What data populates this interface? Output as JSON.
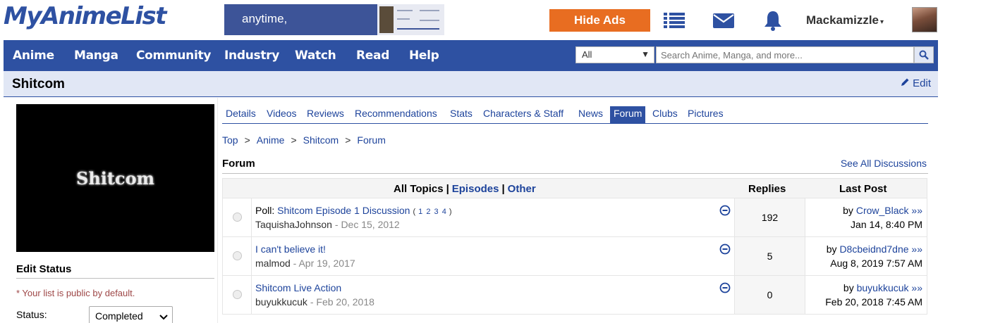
{
  "header": {
    "logo": "MyAnimeList",
    "banner_text": "anytime,",
    "hide_ads_label": "Hide Ads",
    "username": "Mackamizzle",
    "username_caret": "▾"
  },
  "nav": {
    "items": [
      "Anime",
      "Manga",
      "Community",
      "Industry",
      "Watch",
      "Read",
      "Help"
    ],
    "search_category": "All",
    "search_placeholder": "Search Anime, Manga, and more..."
  },
  "page": {
    "title": "Shitcom",
    "edit_label": "Edit",
    "cover_text": "Shitcom"
  },
  "edit_status": {
    "heading": "Edit Status",
    "public_note": "* Your list is public by default.",
    "status_label": "Status:",
    "status_value": "Completed"
  },
  "tabs": [
    "Details",
    "Videos",
    "Reviews",
    "Recommendations",
    "Stats",
    "Characters & Staff",
    "News",
    "Forum",
    "Clubs",
    "Pictures"
  ],
  "active_tab": "Forum",
  "breadcrumb": [
    "Top",
    "Anime",
    "Shitcom",
    "Forum"
  ],
  "breadcrumb_sep": ">",
  "forum": {
    "heading": "Forum",
    "see_all": "See All Discussions",
    "filter_all": "All Topics",
    "filter_episodes": "Episodes",
    "filter_other": "Other",
    "filter_sep": "|",
    "col_replies": "Replies",
    "col_last_post": "Last Post",
    "topics": [
      {
        "prefix": "Poll: ",
        "title": "Shitcom Episode 1 Discussion",
        "pages_open": "(",
        "pages": [
          "1",
          "2",
          "3",
          "4"
        ],
        "pages_close": ")",
        "author": "TaquishaJohnson",
        "date_sep": " - ",
        "date": "Dec 15, 2012",
        "replies": "192",
        "last_by": "by ",
        "last_user": "Crow_Black",
        "last_arrow": "»»",
        "last_time": "Jan 14, 8:40 PM"
      },
      {
        "prefix": "",
        "title": "I can't believe it!",
        "pages_open": "",
        "pages": [],
        "pages_close": "",
        "author": "malmod",
        "date_sep": " - ",
        "date": "Apr 19, 2017",
        "replies": "5",
        "last_by": "by ",
        "last_user": "D8cbeidnd7dne",
        "last_arrow": "»»",
        "last_time": "Aug 8, 2019 7:57 AM"
      },
      {
        "prefix": "",
        "title": "Shitcom Live Action",
        "pages_open": "",
        "pages": [],
        "pages_close": "",
        "author": "buyukkucuk",
        "date_sep": " - ",
        "date": "Feb 20, 2018",
        "replies": "0",
        "last_by": "by ",
        "last_user": "buyukkucuk",
        "last_arrow": "»»",
        "last_time": "Feb 20, 2018 7:45 AM"
      }
    ]
  },
  "colors": {
    "brand": "#2e51a2",
    "link": "#1d439b",
    "hide_ads": "#e86d21",
    "title_bar": "#e1e7f5",
    "note": "#9e4747"
  },
  "icons": [
    "list-icon",
    "mail-icon",
    "bell-icon",
    "search-icon",
    "pencil-icon",
    "minus-circle-icon",
    "radio-icon"
  ]
}
